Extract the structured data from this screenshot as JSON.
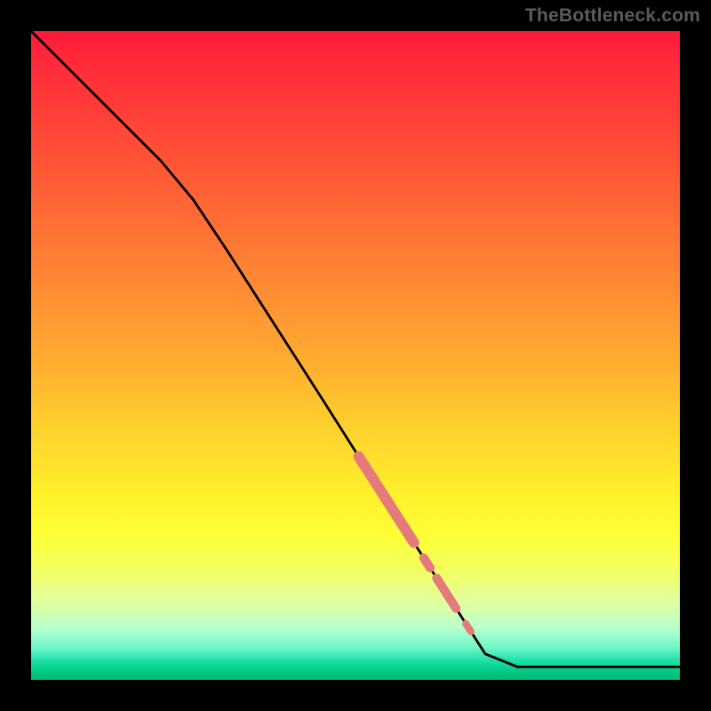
{
  "attribution": "TheBottleneck.com",
  "colors": {
    "curve": "#000000",
    "highlight": "#e47a7a",
    "gradient_top": "#ff1a3a",
    "gradient_bottom": "#00b877"
  },
  "chart_data": {
    "type": "line",
    "title": "",
    "xlabel": "",
    "ylabel": "",
    "xlim": [
      0,
      100
    ],
    "ylim": [
      0,
      100
    ],
    "x": [
      0,
      5,
      10,
      15,
      20,
      25,
      30,
      35,
      40,
      45,
      50,
      55,
      60,
      65,
      70,
      75,
      80,
      85,
      90,
      95,
      100
    ],
    "y": [
      100,
      95,
      90,
      85,
      80,
      74,
      66.5,
      58.7,
      50.9,
      43.1,
      35.2,
      27.4,
      19.6,
      11.8,
      4.0,
      2.0,
      2.0,
      2.0,
      2.0,
      2.0,
      2.0
    ],
    "highlighted_ranges": [
      {
        "x_start": 50.5,
        "x_end": 59.0,
        "width": 12
      },
      {
        "x_start": 60.5,
        "x_end": 61.5,
        "width": 10
      },
      {
        "x_start": 62.5,
        "x_end": 65.5,
        "width": 10
      },
      {
        "x_start": 67.0,
        "x_end": 67.8,
        "width": 8
      }
    ],
    "background": "vertical-heat-gradient",
    "grid": false,
    "legend": false
  }
}
